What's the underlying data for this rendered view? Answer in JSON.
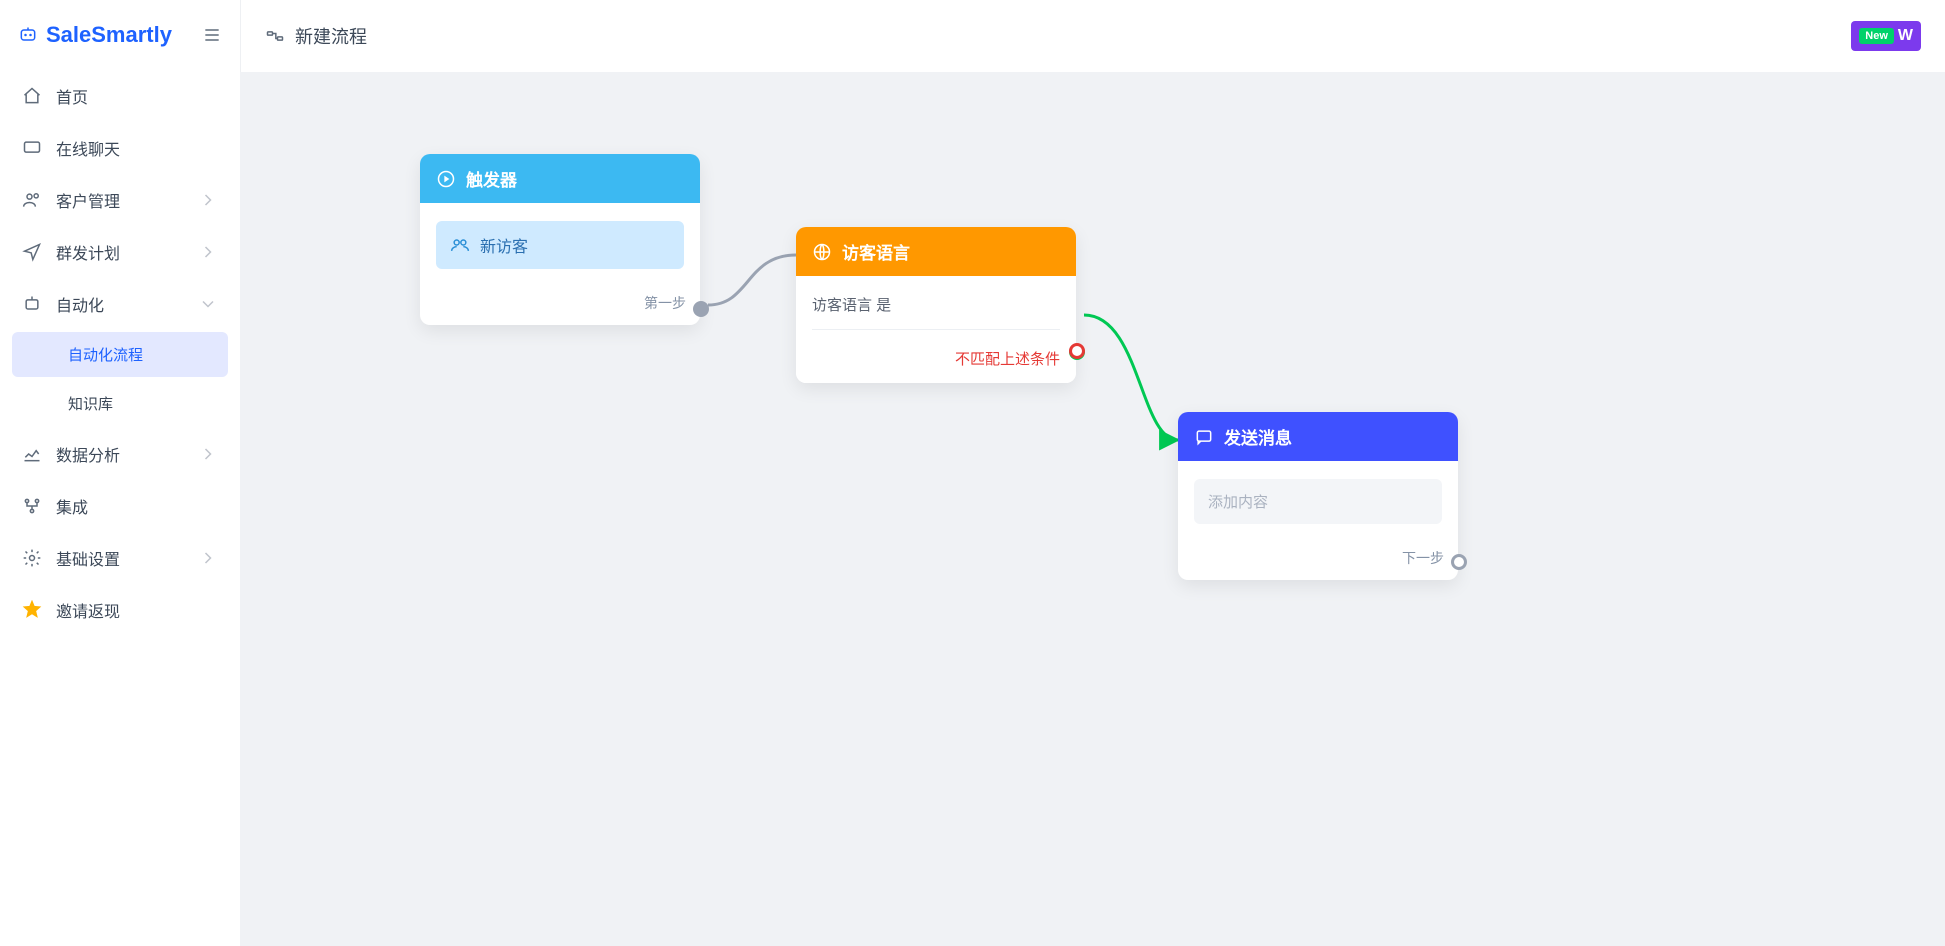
{
  "brand": {
    "name": "SaleSmartly"
  },
  "topbar": {
    "title": "新建流程",
    "new_badge": "New",
    "w_label": "W"
  },
  "sidebar": {
    "items": {
      "home": {
        "label": "首页"
      },
      "chat": {
        "label": "在线聊天"
      },
      "customer": {
        "label": "客户管理"
      },
      "broadcast": {
        "label": "群发计划"
      },
      "automation": {
        "label": "自动化"
      },
      "automation_flow": {
        "label": "自动化流程"
      },
      "kb": {
        "label": "知识库"
      },
      "analytics": {
        "label": "数据分析"
      },
      "integration": {
        "label": "集成"
      },
      "settings": {
        "label": "基础设置"
      },
      "invite": {
        "label": "邀请返现"
      }
    }
  },
  "flow": {
    "trigger": {
      "title": "触发器",
      "chip": "新访客",
      "footer": "第一步"
    },
    "condition": {
      "title": "访客语言",
      "line": "访客语言 是",
      "no_match": "不匹配上述条件"
    },
    "action": {
      "title": "发送消息",
      "placeholder": "添加内容",
      "footer": "下一步"
    }
  }
}
